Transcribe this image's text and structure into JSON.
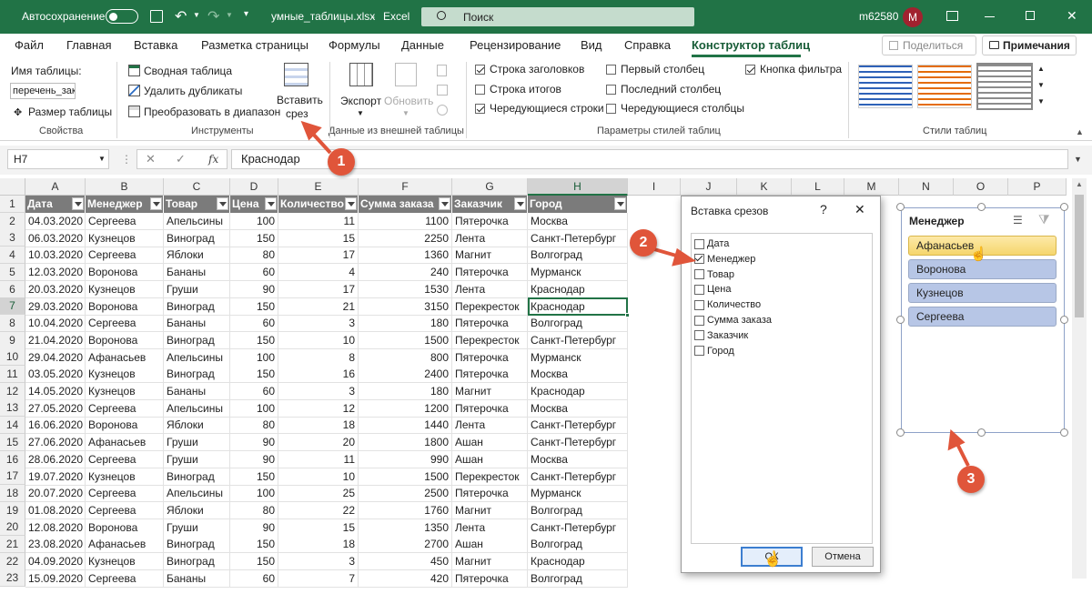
{
  "titlebar": {
    "autosave": "Автосохранение",
    "filename": "умные_таблицы.xlsx",
    "sep": "-",
    "app": "Excel",
    "search": "Поиск",
    "user": "m62580",
    "avatar": "M"
  },
  "tabs": [
    "Файл",
    "Главная",
    "Вставка",
    "Разметка страницы",
    "Формулы",
    "Данные",
    "Рецензирование",
    "Вид",
    "Справка",
    "Конструктор таблиц"
  ],
  "share": "Поделиться",
  "notes": "Примечания",
  "ribbon": {
    "table_name_label": "Имя таблицы:",
    "table_name_value": "перечень_зак",
    "resize": "Размер таблицы",
    "group_props": "Свойства",
    "pivot": "Сводная таблица",
    "remove_dup": "Удалить дубликаты",
    "convert": "Преобразовать в диапазон",
    "slicer_1": "Вставить",
    "slicer_2": "срез",
    "group_tools": "Инструменты",
    "export": "Экспорт",
    "refresh": "Обновить",
    "group_ext": "Данные из внешней таблицы",
    "opt_header": "Строка заголовков",
    "opt_total": "Строка итогов",
    "opt_banded_rows": "Чередующиеся строки",
    "opt_first_col": "Первый столбец",
    "opt_last_col": "Последний столбец",
    "opt_banded_cols": "Чередующиеся столбцы",
    "opt_filter": "Кнопка фильтра",
    "group_opts": "Параметры стилей таблиц",
    "group_styles": "Стили таблиц"
  },
  "formula": {
    "namebox": "H7",
    "value": "Краснодар",
    "fx": "fx"
  },
  "columns": [
    "A",
    "B",
    "C",
    "D",
    "E",
    "F",
    "G",
    "H",
    "I",
    "J",
    "K",
    "L",
    "M",
    "N",
    "O",
    "P"
  ],
  "headers": [
    "Дата",
    "Менеджер",
    "Товар",
    "Цена",
    "Количество",
    "Сумма заказа",
    "Заказчик",
    "Город"
  ],
  "rows": [
    [
      "04.03.2020",
      "Сергеева",
      "Апельсины",
      "100",
      "11",
      "1100",
      "Пятерочка",
      "Москва"
    ],
    [
      "06.03.2020",
      "Кузнецов",
      "Виноград",
      "150",
      "15",
      "2250",
      "Лента",
      "Санкт-Петербург"
    ],
    [
      "10.03.2020",
      "Сергеева",
      "Яблоки",
      "80",
      "17",
      "1360",
      "Магнит",
      "Волгоград"
    ],
    [
      "12.03.2020",
      "Воронова",
      "Бананы",
      "60",
      "4",
      "240",
      "Пятерочка",
      "Мурманск"
    ],
    [
      "20.03.2020",
      "Кузнецов",
      "Груши",
      "90",
      "17",
      "1530",
      "Лента",
      "Краснодар"
    ],
    [
      "29.03.2020",
      "Воронова",
      "Виноград",
      "150",
      "21",
      "3150",
      "Перекресток",
      "Краснодар"
    ],
    [
      "10.04.2020",
      "Сергеева",
      "Бананы",
      "60",
      "3",
      "180",
      "Пятерочка",
      "Волгоград"
    ],
    [
      "21.04.2020",
      "Воронова",
      "Виноград",
      "150",
      "10",
      "1500",
      "Перекресток",
      "Санкт-Петербург"
    ],
    [
      "29.04.2020",
      "Афанасьев",
      "Апельсины",
      "100",
      "8",
      "800",
      "Пятерочка",
      "Мурманск"
    ],
    [
      "03.05.2020",
      "Кузнецов",
      "Виноград",
      "150",
      "16",
      "2400",
      "Пятерочка",
      "Москва"
    ],
    [
      "14.05.2020",
      "Кузнецов",
      "Бананы",
      "60",
      "3",
      "180",
      "Магнит",
      "Краснодар"
    ],
    [
      "27.05.2020",
      "Сергеева",
      "Апельсины",
      "100",
      "12",
      "1200",
      "Пятерочка",
      "Москва"
    ],
    [
      "16.06.2020",
      "Воронова",
      "Яблоки",
      "80",
      "18",
      "1440",
      "Лента",
      "Санкт-Петербург"
    ],
    [
      "27.06.2020",
      "Афанасьев",
      "Груши",
      "90",
      "20",
      "1800",
      "Ашан",
      "Санкт-Петербург"
    ],
    [
      "28.06.2020",
      "Сергеева",
      "Груши",
      "90",
      "11",
      "990",
      "Ашан",
      "Москва"
    ],
    [
      "19.07.2020",
      "Кузнецов",
      "Виноград",
      "150",
      "10",
      "1500",
      "Перекресток",
      "Санкт-Петербург"
    ],
    [
      "20.07.2020",
      "Сергеева",
      "Апельсины",
      "100",
      "25",
      "2500",
      "Пятерочка",
      "Мурманск"
    ],
    [
      "01.08.2020",
      "Сергеева",
      "Яблоки",
      "80",
      "22",
      "1760",
      "Магнит",
      "Волгоград"
    ],
    [
      "12.08.2020",
      "Воронова",
      "Груши",
      "90",
      "15",
      "1350",
      "Лента",
      "Санкт-Петербург"
    ],
    [
      "23.08.2020",
      "Афанасьев",
      "Виноград",
      "150",
      "18",
      "2700",
      "Ашан",
      "Волгоград"
    ],
    [
      "04.09.2020",
      "Кузнецов",
      "Виноград",
      "150",
      "3",
      "450",
      "Магнит",
      "Краснодар"
    ],
    [
      "15.09.2020",
      "Сергеева",
      "Бананы",
      "60",
      "7",
      "420",
      "Пятерочка",
      "Волгоград"
    ]
  ],
  "row_numbers": [
    "1",
    "2",
    "3",
    "4",
    "5",
    "6",
    "7",
    "8",
    "9",
    "10",
    "11",
    "12",
    "13",
    "14",
    "15",
    "16",
    "17",
    "18",
    "19",
    "20",
    "21",
    "22",
    "23"
  ],
  "dialog": {
    "title": "Вставка срезов",
    "help": "?",
    "close": "✕",
    "items": [
      "Дата",
      "Менеджер",
      "Товар",
      "Цена",
      "Количество",
      "Сумма заказа",
      "Заказчик",
      "Город"
    ],
    "checked": [
      false,
      true,
      false,
      false,
      false,
      false,
      false,
      false
    ],
    "ok": "ОК",
    "cancel": "Отмена"
  },
  "slicer": {
    "title": "Менеджер",
    "items": [
      "Афанасьев",
      "Воронова",
      "Кузнецов",
      "Сергеева"
    ]
  },
  "badges": [
    "1",
    "2",
    "3"
  ],
  "colors": {
    "excel_green": "#217346",
    "header_gray": "#7b7b7b",
    "slicer_selected": "#f5d66c",
    "slicer_item": "#b7c6e6",
    "badge": "#e0553a"
  }
}
